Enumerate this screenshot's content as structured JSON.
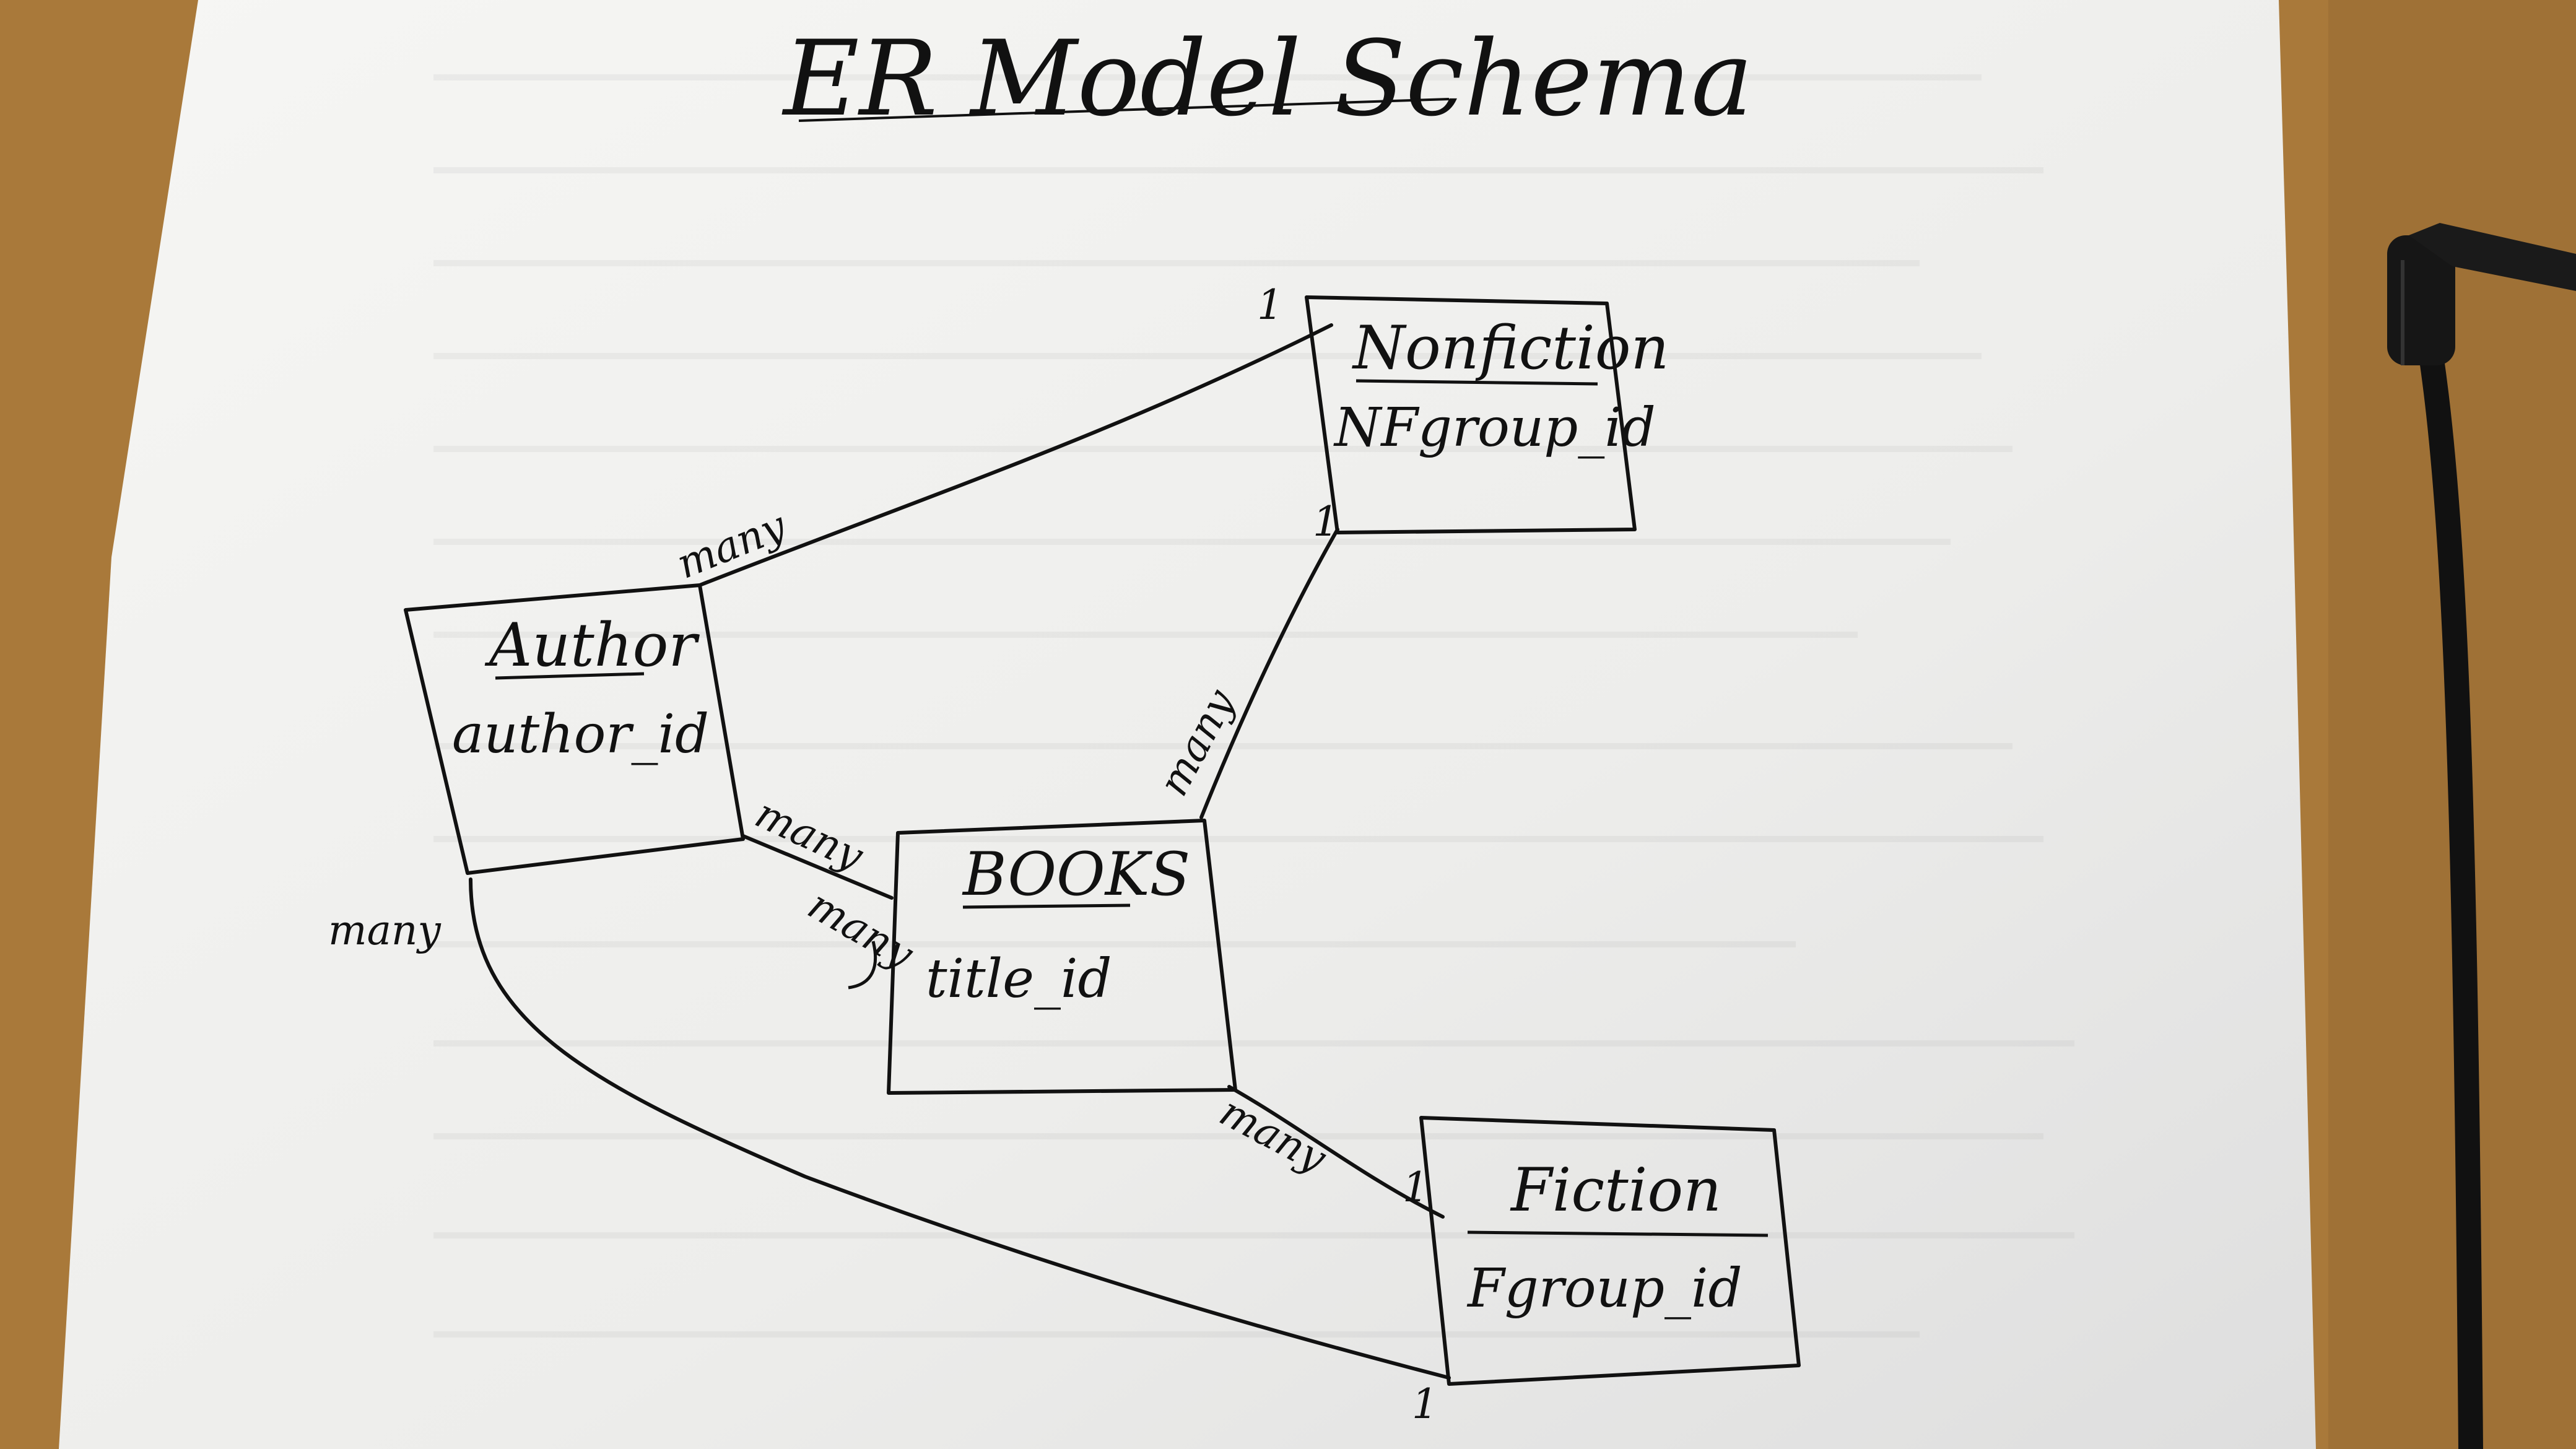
{
  "title": "ER Model Schema",
  "entities": [
    {
      "id": "nonfiction",
      "name": "Nonfiction",
      "attribute": "NFgroup_id"
    },
    {
      "id": "author",
      "name": "Author",
      "attribute": "author_id"
    },
    {
      "id": "books",
      "name": "BOOKS",
      "attribute": "title_id"
    },
    {
      "id": "fiction",
      "name": "Fiction",
      "attribute": "Fgroup_id"
    }
  ],
  "relationships": [
    {
      "from": "author",
      "to": "nonfiction",
      "from_card": "many",
      "to_card": "1"
    },
    {
      "from": "books",
      "to": "nonfiction",
      "from_card": "many",
      "to_card": "1"
    },
    {
      "from": "author",
      "to": "books",
      "from_card": "many",
      "to_card": "many"
    },
    {
      "from": "books",
      "to": "fiction",
      "from_card": "many",
      "to_card": "1"
    },
    {
      "from": "author",
      "to": "fiction",
      "from_card": "many",
      "to_card": "1"
    }
  ],
  "colors": {
    "desk": "#a9793a",
    "paper": "#f2f2f0",
    "ink": "#111111",
    "cable": "#111111"
  }
}
